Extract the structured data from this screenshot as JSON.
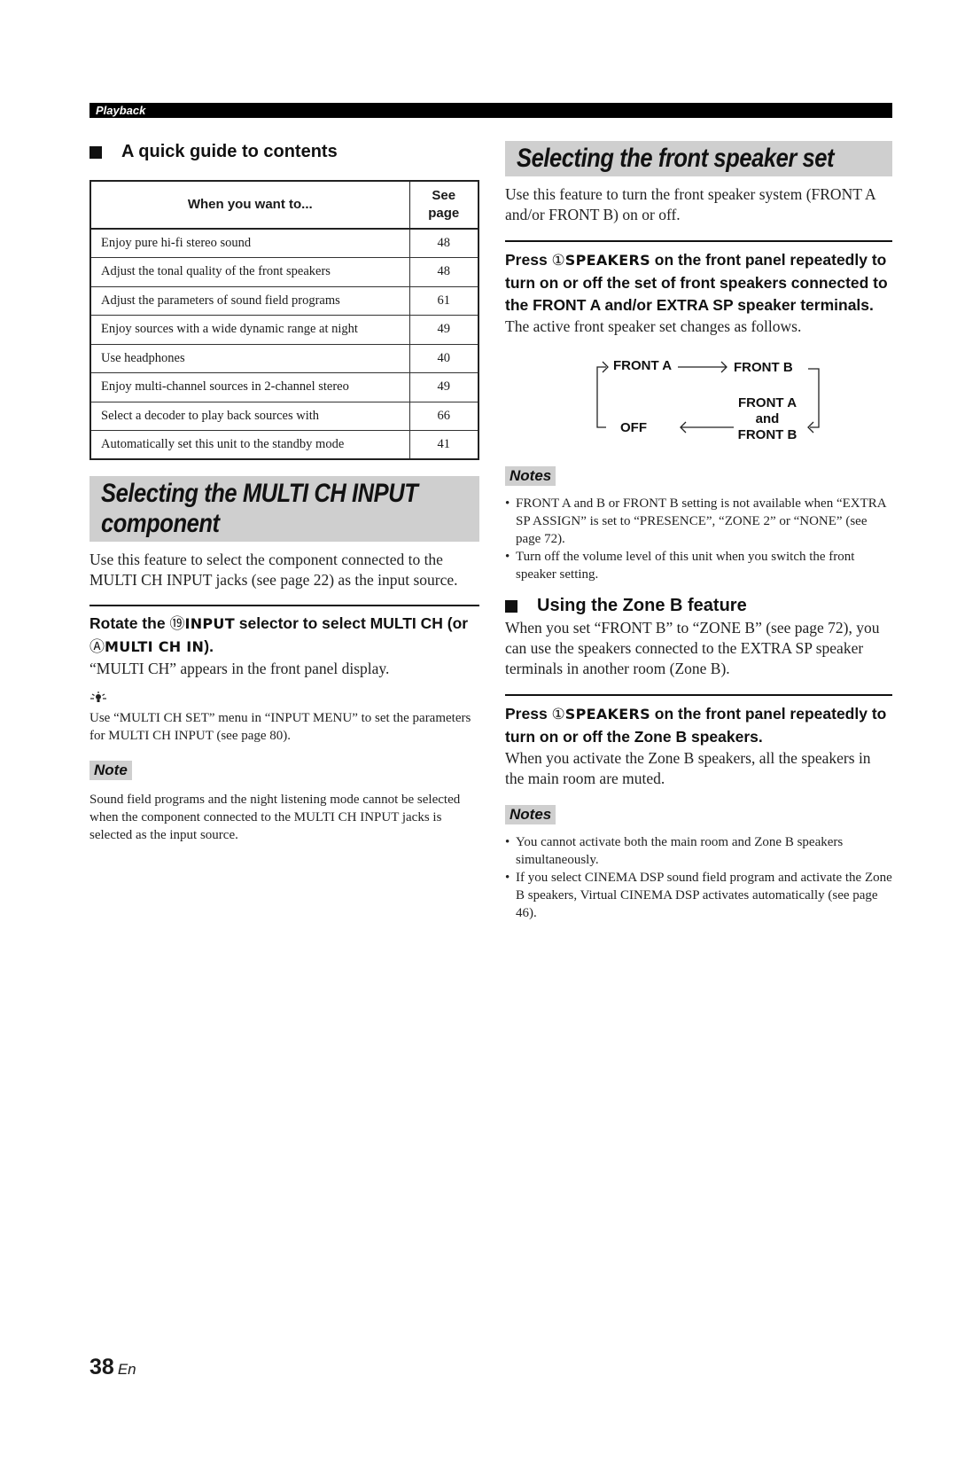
{
  "header": {
    "section": "Playback"
  },
  "quick_guide": {
    "title": "A quick guide to contents",
    "columns": [
      "When you want to...",
      "See page"
    ],
    "rows": [
      {
        "task": "Enjoy pure hi-fi stereo sound",
        "page": "48"
      },
      {
        "task": "Adjust the tonal quality of the front speakers",
        "page": "48"
      },
      {
        "task": "Adjust the parameters of sound field programs",
        "page": "61"
      },
      {
        "task": "Enjoy sources with a wide dynamic range at night",
        "page": "49"
      },
      {
        "task": "Use headphones",
        "page": "40"
      },
      {
        "task": "Enjoy multi-channel sources in 2-channel stereo",
        "page": "49"
      },
      {
        "task": "Select a decoder to play back sources with",
        "page": "66"
      },
      {
        "task": "Automatically set this unit to the standby mode",
        "page": "41"
      }
    ]
  },
  "multi_ch": {
    "title_line1": "Selecting the MULTI CH INPUT",
    "title_line2": "component",
    "intro": "Use this feature to select the component connected to the MULTI CH INPUT jacks (see page 22) as the input source.",
    "step": {
      "pre": "Rotate the ",
      "num": "⑲",
      "key": "INPUT",
      "mid": " selector to select MULTI CH (or ",
      "num2": "Ⓐ",
      "key2": "MULTI CH IN",
      "post": ")."
    },
    "result": "“MULTI CH” appears in the front panel display.",
    "tip_icon": "lightbulb-tip",
    "tip": "Use “MULTI CH SET” menu in “INPUT MENU” to set the parameters for MULTI CH INPUT (see page 80).",
    "note_label": "Note",
    "note": "Sound field programs and the night listening mode cannot be selected when the component connected to the MULTI CH INPUT jacks is selected as the input source."
  },
  "front_speaker": {
    "title": "Selecting the front speaker set",
    "intro": "Use this feature to turn the front speaker system (FRONT A and/or FRONT B) on or off.",
    "step": {
      "pre": "Press ",
      "num": "①",
      "key": "SPEAKERS",
      "post": " on the front panel repeatedly to turn on or off the set of front speakers connected to the FRONT A and/or EXTRA SP speaker terminals."
    },
    "result": "The active front speaker set changes as follows.",
    "diagram": {
      "front_a": "FRONT A",
      "front_b": "FRONT B",
      "both_line1": "FRONT A",
      "both_line2": "and",
      "both_line3": "FRONT B",
      "off": "OFF"
    },
    "notes_label": "Notes",
    "notes": [
      "FRONT A and B or FRONT B setting is not available when “EXTRA SP ASSIGN” is set to “PRESENCE”, “ZONE 2” or “NONE” (see page 72).",
      "Turn off the volume level of this unit when you switch the front speaker setting."
    ]
  },
  "zone_b": {
    "title": "Using the Zone B feature",
    "intro": "When you set “FRONT B” to “ZONE B” (see page 72), you can use the speakers connected to the EXTRA SP speaker terminals in another room (Zone B).",
    "step": {
      "pre": "Press ",
      "num": "①",
      "key": "SPEAKERS",
      "post": " on the front panel repeatedly to turn on or off the Zone B speakers."
    },
    "result": "When you activate the Zone B speakers, all the speakers in the main room are muted.",
    "notes_label": "Notes",
    "notes": [
      "You cannot activate both the main room and Zone B speakers simultaneously.",
      "If you select CINEMA DSP sound field program and activate the Zone B speakers, Virtual CINEMA DSP activates automatically (see page 46)."
    ]
  },
  "footer": {
    "page_number": "38",
    "language": "En"
  }
}
